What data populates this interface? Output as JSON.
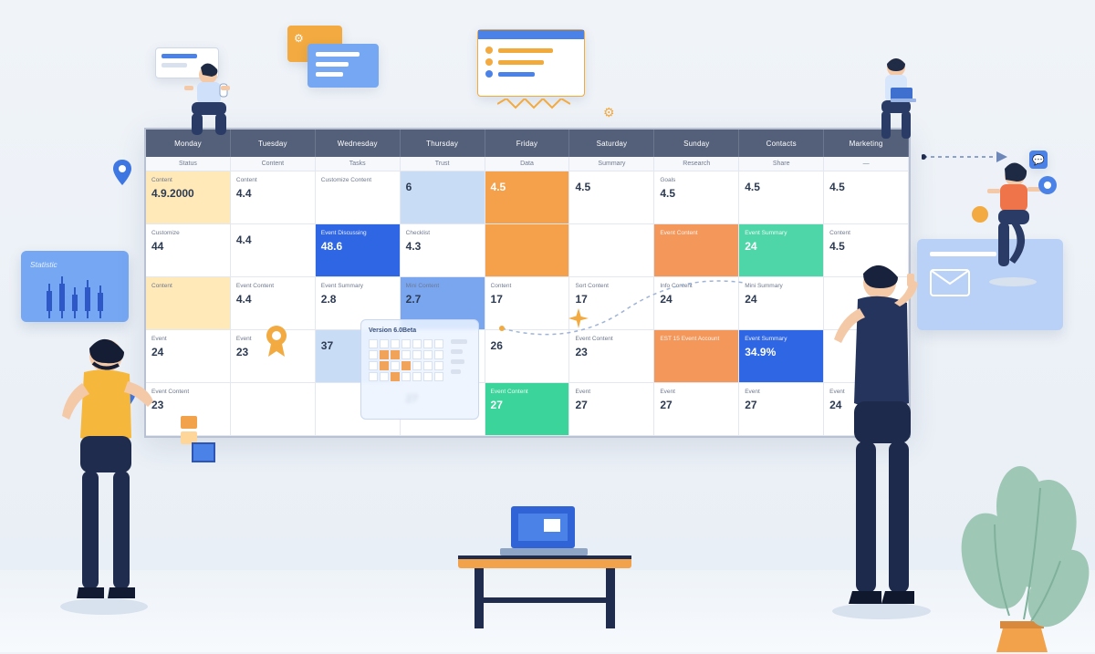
{
  "board": {
    "columns": [
      "Monday",
      "Tuesday",
      "Wednesday",
      "Thursday",
      "Friday",
      "Saturday",
      "Sunday",
      "Contacts",
      "Marketing"
    ],
    "sub": [
      "Status",
      "Content",
      "Tasks",
      "Trust",
      "Data",
      "Summary",
      "Research",
      "Share",
      "—"
    ],
    "rows": [
      [
        {
          "label": "Content",
          "num": "4.9.2000",
          "c": "yellow"
        },
        {
          "label": "Content",
          "num": "4.4"
        },
        {
          "label": "Customize Content",
          "num": ""
        },
        {
          "label": "",
          "num": "6",
          "c": "blue-l"
        },
        {
          "label": "",
          "num": "4.5",
          "c": "orange-s"
        },
        {
          "label": "",
          "num": "4.5"
        },
        {
          "label": "Goals",
          "num": "4.5"
        },
        {
          "label": "",
          "num": "4.5"
        },
        {
          "label": "",
          "num": "4.5"
        }
      ],
      [
        {
          "label": "Customize",
          "num": "44"
        },
        {
          "label": "",
          "num": "4.4"
        },
        {
          "label": "Event Discussing",
          "num": "48.6",
          "c": "blue-m"
        },
        {
          "label": "Checklist",
          "num": "4.3"
        },
        {
          "label": "",
          "num": "",
          "c": "orange-s"
        },
        {
          "label": "",
          "num": ""
        },
        {
          "label": "Event Content",
          "num": "",
          "c": "orange-m"
        },
        {
          "label": "Event Summary",
          "num": "24",
          "c": "green-l"
        },
        {
          "label": "Content",
          "num": "4.5"
        }
      ],
      [
        {
          "label": "Content",
          "num": "",
          "c": "yellow"
        },
        {
          "label": "Event Content",
          "num": "4.4"
        },
        {
          "label": "Event Summary",
          "num": "2.8"
        },
        {
          "label": "Mini Content",
          "num": "2.7",
          "c": "blue-d"
        },
        {
          "label": "Content",
          "num": "17"
        },
        {
          "label": "Sort Content",
          "num": "17"
        },
        {
          "label": "Info Content",
          "num": "24"
        },
        {
          "label": "Mini Summary",
          "num": "24"
        },
        {
          "label": "",
          "num": ""
        }
      ],
      [
        {
          "label": "Event",
          "num": "24"
        },
        {
          "label": "Event",
          "num": "23"
        },
        {
          "label": "",
          "num": "37",
          "c": "blue-l"
        },
        {
          "label": "",
          "num": ""
        },
        {
          "label": "",
          "num": "26"
        },
        {
          "label": "Event Content",
          "num": "23"
        },
        {
          "label": "EST 15 Event Account",
          "num": "",
          "c": "orange-m"
        },
        {
          "label": "Event Summary",
          "num": "34.9%",
          "c": "blue-m"
        },
        {
          "label": "",
          "num": ""
        }
      ],
      [
        {
          "label": "Event Content",
          "num": "23"
        },
        {
          "label": "",
          "num": ""
        },
        {
          "label": "",
          "num": ""
        },
        {
          "label": "",
          "num": "27"
        },
        {
          "label": "Event Content",
          "num": "27",
          "c": "green"
        },
        {
          "label": "Event",
          "num": "27"
        },
        {
          "label": "Event",
          "num": "27"
        },
        {
          "label": "Event",
          "num": "27"
        },
        {
          "label": "Event",
          "num": "24"
        }
      ]
    ]
  },
  "analytics": {
    "title": "Statistic"
  },
  "minical": {
    "title": "Version 6.0Beta"
  },
  "cellValues": {
    "r0c0_label": "Content",
    "r0c0_num": "4.9.2000",
    "r0c1_num": "4.4",
    "r0c3_num": "6",
    "r0c4_num": "4.5",
    "r0c5_num": "4.5",
    "r0c6_num": "4.5",
    "r0c7_num": "4.5",
    "r0c8_num": "4.5",
    "r1c0_num": "44",
    "r1c1_num": "4.4",
    "r1c2_num": "48.6",
    "r1c3_num": "4.3",
    "r1c7_num": "24",
    "r1c8_num": "4.5",
    "r2c1_num": "4.4",
    "r2c2_num": "2.8",
    "r2c3_num": "2.7",
    "r2c4_num": "17",
    "r2c5_num": "17",
    "r2c6_num": "24",
    "r2c7_num": "24",
    "r3c0_num": "24",
    "r3c1_num": "23",
    "r3c2_num": "37",
    "r3c4_num": "26",
    "r3c5_num": "23",
    "r3c7_num": "34.9%",
    "r4c0_num": "23",
    "r4c3_num": "27",
    "r4c4_num": "27",
    "r4c5_num": "27",
    "r4c6_num": "27",
    "r4c7_num": "27",
    "r4c8_num": "24"
  }
}
